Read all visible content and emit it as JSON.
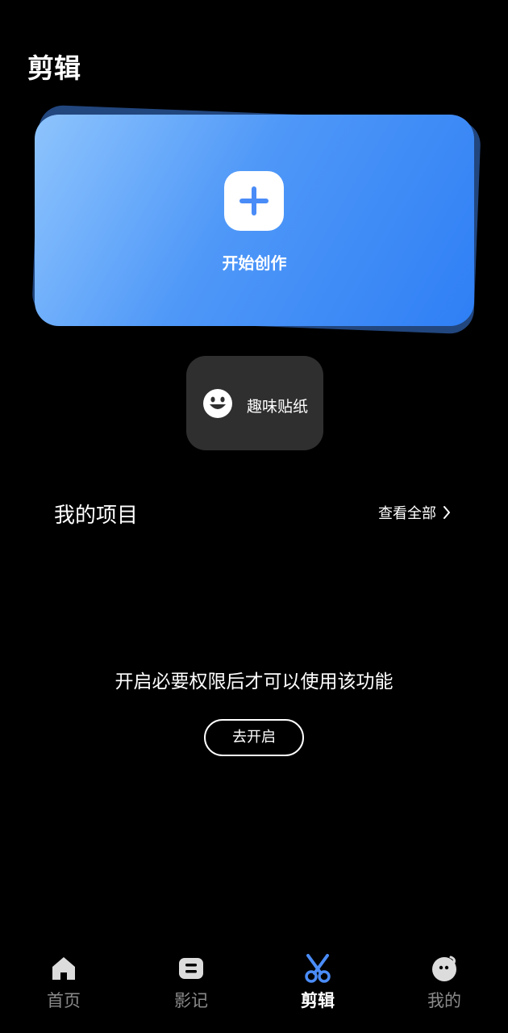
{
  "header": {
    "title": "剪辑"
  },
  "create_card": {
    "label": "开始创作"
  },
  "sticker": {
    "label": "趣味贴纸"
  },
  "projects": {
    "title": "我的项目",
    "view_all": "查看全部"
  },
  "permission": {
    "message": "开启必要权限后才可以使用该功能",
    "button": "去开启"
  },
  "bottom_nav": {
    "items": [
      {
        "label": "首页",
        "icon": "home-icon",
        "active": false
      },
      {
        "label": "影记",
        "icon": "memories-icon",
        "active": false
      },
      {
        "label": "剪辑",
        "icon": "scissors-icon",
        "active": true
      },
      {
        "label": "我的",
        "icon": "profile-icon",
        "active": false
      }
    ]
  },
  "colors": {
    "background": "#000000",
    "card_gradient_start": "#8ec4fd",
    "card_gradient_end": "#2f7ff5",
    "tile_bg": "#2f2f2f",
    "accent": "#4a8cf7",
    "nav_inactive": "#8a8a8a"
  }
}
